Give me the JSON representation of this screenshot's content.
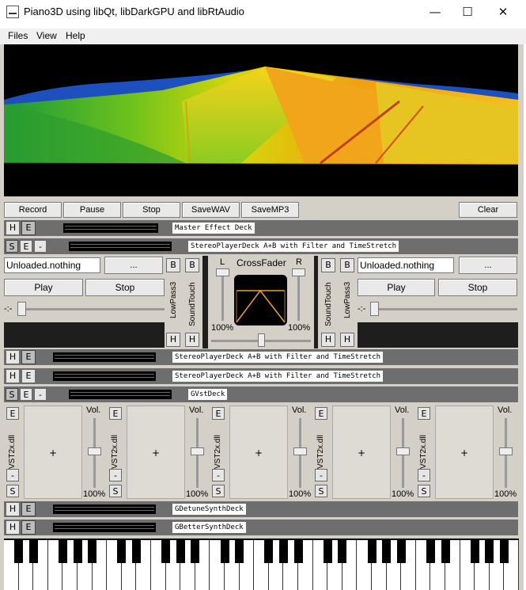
{
  "window": {
    "title": "Piano3D using libQt, libDarkGPU and libRtAudio"
  },
  "menu": [
    "Files",
    "View",
    "Help"
  ],
  "toolbar": {
    "record": "Record",
    "pause": "Pause",
    "stop": "Stop",
    "save_wav": "SaveWAV",
    "save_mp3": "SaveMP3",
    "clear": "Clear"
  },
  "decks": {
    "master": "Master Effect Deck",
    "player1": "StereoPlayerDeck A+B with Filter and TimeStretch",
    "player2": "StereoPlayerDeck A+B with Filter and TimeStretch",
    "player3": "StereoPlayerDeck A+B with Filter and TimeStretch",
    "vst": "GVstDeck",
    "detune": "GDetuneSynthDeck",
    "better": "GBetterSynthDeck"
  },
  "buttons": {
    "h": "H",
    "e": "E",
    "s": "S",
    "minus": "-",
    "b": "B",
    "dots": "...",
    "plus": "+"
  },
  "player": {
    "left": {
      "file": "Unloaded.nothing",
      "play": "Play",
      "stop": "Stop",
      "pos_label": "-:-"
    },
    "right": {
      "file": "Unloaded.nothing",
      "play": "Play",
      "stop": "Stop",
      "pos_label": "-:-"
    }
  },
  "filters": {
    "lowpass": "LowPass3",
    "soundtouch": "SoundTouch"
  },
  "crossfader": {
    "title": "CrossFader",
    "l": "L",
    "r": "R",
    "left_pct": "100%",
    "right_pct": "100%"
  },
  "vst_slots": [
    {
      "name": "VST2x.dll",
      "vol_label": "Vol.",
      "vol_pct": "100%"
    },
    {
      "name": "VST2x.dll",
      "vol_label": "Vol.",
      "vol_pct": "100%"
    },
    {
      "name": "VST2x.dll",
      "vol_label": "Vol.",
      "vol_pct": "100%"
    },
    {
      "name": "VST2x.dll",
      "vol_label": "Vol.",
      "vol_pct": "100%"
    },
    {
      "name": "VST2x.dll",
      "vol_label": "Vol.",
      "vol_pct": "100%"
    }
  ],
  "colors": {
    "panel": "#d4d0c8",
    "deck_bar": "#6e6e6e",
    "meter": "#000000",
    "crossfader_line": "#f0a030"
  }
}
